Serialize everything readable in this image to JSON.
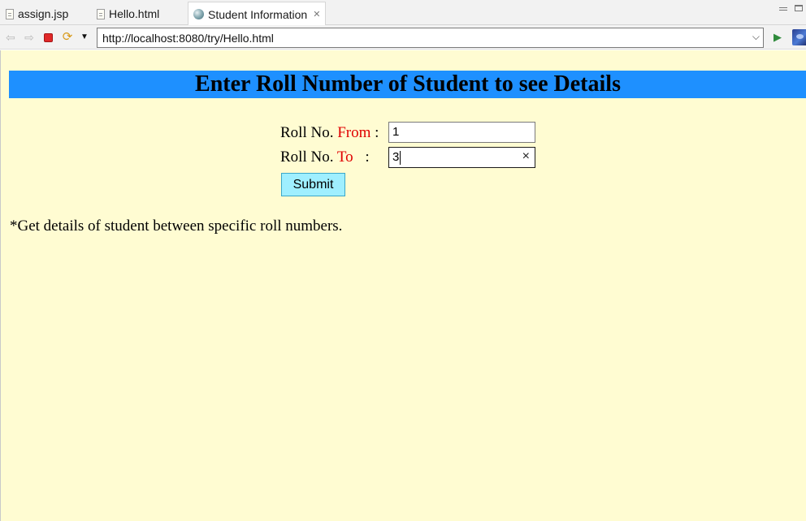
{
  "tabs": [
    {
      "label": "assign.jsp",
      "icon": "file-icon"
    },
    {
      "label": "Hello.html",
      "icon": "file-icon"
    },
    {
      "label": "Student Information",
      "icon": "globe-icon",
      "active": true,
      "close": "✕"
    }
  ],
  "toolbar": {
    "url": "http://localhost:8080/try/Hello.html"
  },
  "page": {
    "heading": "Enter Roll Number of Student to see Details",
    "from_label_prefix": "Roll No.",
    "from_label_keyword": "From",
    "from_label_suffix": ":",
    "to_label_prefix": "Roll No.",
    "to_label_keyword": "To",
    "to_label_suffix": ":",
    "from_value": "1",
    "to_value": "3",
    "clear_symbol": "×",
    "submit_label": "Submit",
    "note": "*Get details of student between specific roll numbers."
  },
  "colors": {
    "heading_bg": "#1e90ff",
    "page_bg": "#fffcd2",
    "keyword": "#e00000",
    "submit_bg": "#9fefff"
  }
}
